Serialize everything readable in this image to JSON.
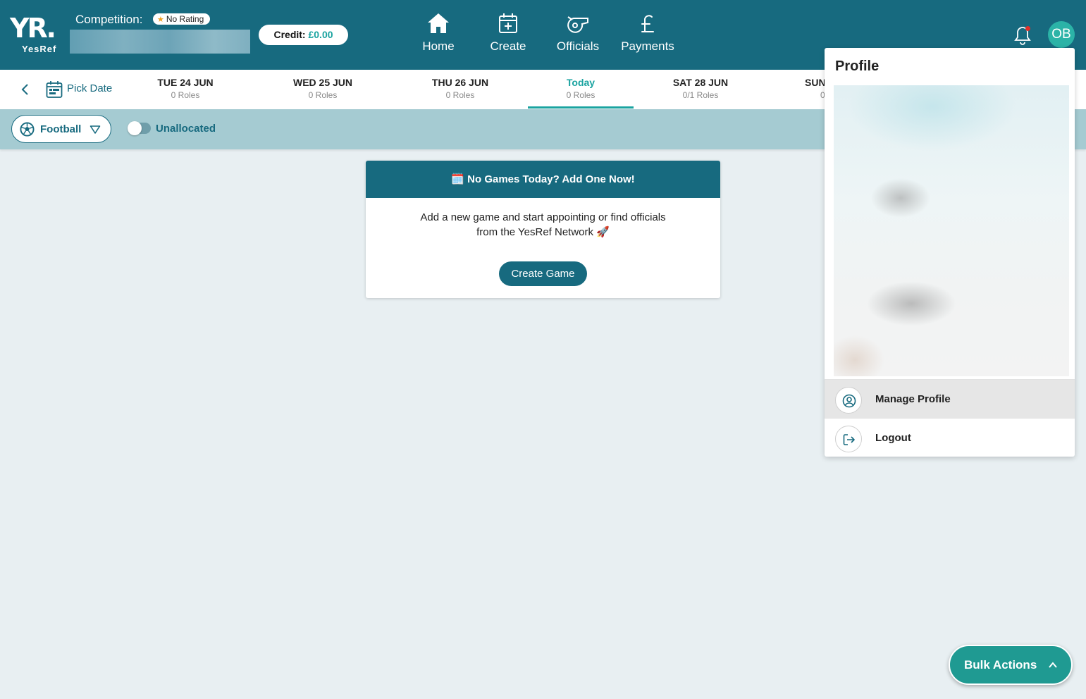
{
  "header": {
    "logo_main": "YR.",
    "logo_sub": "YesRef",
    "competition_label": "Competition:",
    "rating_label": "No Rating",
    "credit_label": "Credit:",
    "credit_amount": "£0.00",
    "nav": [
      {
        "label": "Home",
        "icon": "home-icon"
      },
      {
        "label": "Create",
        "icon": "calendar-plus-icon"
      },
      {
        "label": "Officials",
        "icon": "whistle-icon"
      },
      {
        "label": "Payments",
        "icon": "pound-icon"
      }
    ],
    "avatar_initials": "OB",
    "notification_dot_color": "#e0302a"
  },
  "datebar": {
    "pick_date_label": "Pick Date",
    "days": [
      {
        "name": "TUE 24 JUN",
        "roles": "0 Roles"
      },
      {
        "name": "WED 25 JUN",
        "roles": "0 Roles"
      },
      {
        "name": "THU 26 JUN",
        "roles": "0 Roles"
      },
      {
        "name": "Today",
        "roles": "0 Roles"
      },
      {
        "name": "SAT 28 JUN",
        "roles": "0/1 Roles"
      },
      {
        "name": "SUN",
        "roles": "0"
      }
    ]
  },
  "filters": {
    "sport": "Football",
    "unallocated_label": "Unallocated",
    "unallocated_on": false
  },
  "empty_card": {
    "title": "🗓️ No Games Today? Add One Now!",
    "body_line1": "Add a new game and start appointing or find officials",
    "body_line2": "from the YesRef Network 🚀",
    "button": "Create Game"
  },
  "profile_menu": {
    "title": "Profile",
    "items": [
      {
        "label": "Manage Profile",
        "icon": "user-circle-icon"
      },
      {
        "label": "Logout",
        "icon": "logout-icon"
      }
    ]
  },
  "bulk_actions": {
    "label": "Bulk Actions"
  },
  "colors": {
    "primary": "#176a7f",
    "accent": "#1aa3a0",
    "filter_bar": "#a5cbd2",
    "bulk_button": "#1f9a92"
  }
}
